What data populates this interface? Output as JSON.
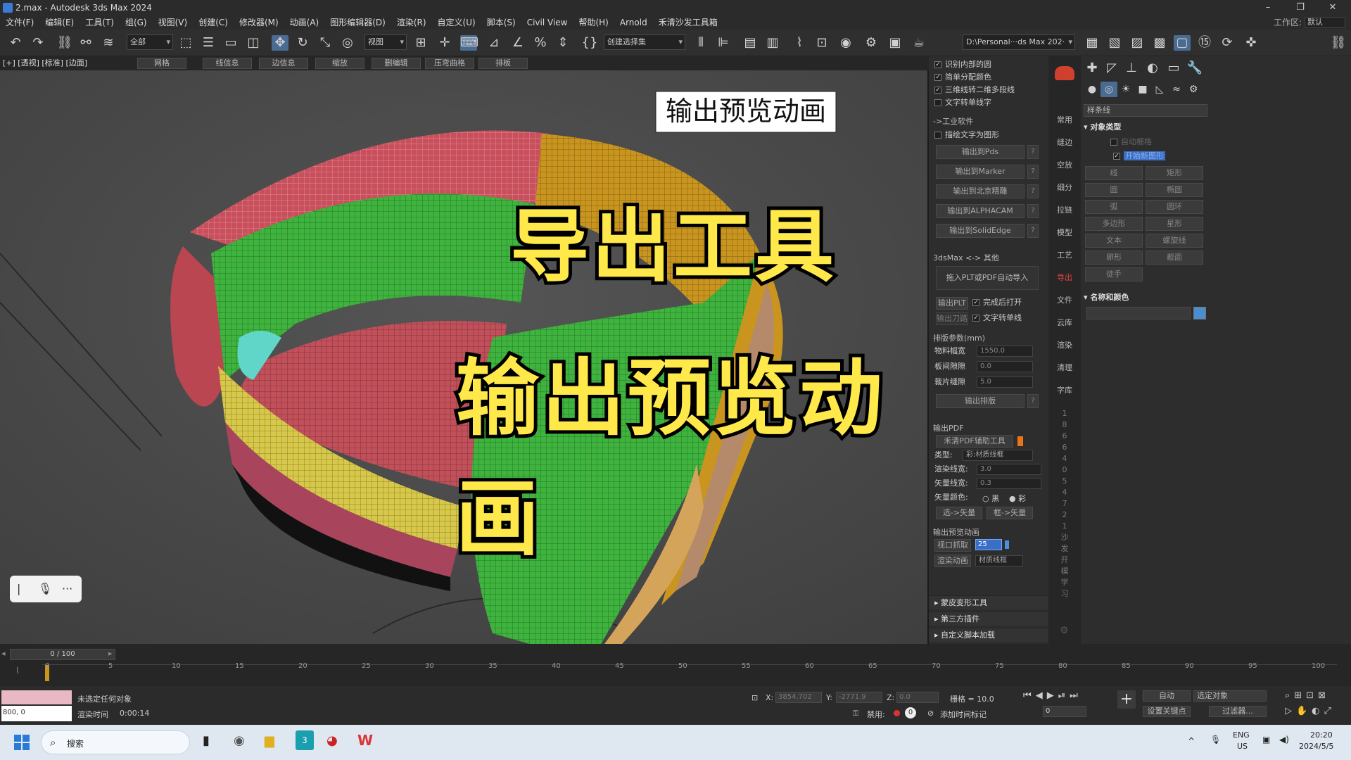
{
  "window": {
    "title": "2.max - Autodesk 3ds Max 2024",
    "minimize": "–",
    "maximize": "❐",
    "close": "✕"
  },
  "menu": {
    "items": [
      "文件(F)",
      "编辑(E)",
      "工具(T)",
      "组(G)",
      "视图(V)",
      "创建(C)",
      "修改器(M)",
      "动画(A)",
      "图形编辑器(D)",
      "渲染(R)",
      "自定义(U)",
      "脚本(S)",
      "Civil View",
      "帮助(H)",
      "Arnold",
      "禾清沙发工具箱"
    ],
    "workspace_label": "工作区:",
    "workspace_value": "默认"
  },
  "toolbar": {
    "selection_filter": "全部",
    "ref_coord": "视图",
    "named_set": "创建选择集",
    "path": "D:\\Personal···ds Max 202·"
  },
  "viewport": {
    "label": "[+] [透视] [标准] [边面]",
    "ribbon": [
      "网格",
      "线信息",
      "边信息",
      "缩放",
      "删编辑",
      "压弯曲格",
      "排板"
    ],
    "caption_box": "输出预览动画",
    "overlay_title": "导出工具",
    "overlay_subtitle": "输出预览动画"
  },
  "cmd": {
    "checks": [
      {
        "label": "识别内部的圆",
        "checked": true
      },
      {
        "label": "简单分配颜色",
        "checked": true
      },
      {
        "label": "三维线转二维多段线",
        "checked": true
      },
      {
        "label": "文字转单线字",
        "checked": false
      }
    ],
    "industrial_label": "->工业软件",
    "check_text_to_shape": "描绘文字为图形",
    "export_buttons": [
      "输出到Pds",
      "输出到Marker",
      "输出到北京精雕",
      "输出到ALPHACAM",
      "输出到SolidEdge"
    ],
    "help": "?",
    "other_label": "3dsMax <-> 其他",
    "drag_label": "拖入PLT或PDF自动导入",
    "plt_btn": "输出PLT",
    "knife_btn": "输出刀路",
    "open_after": "完成后打开",
    "text_to_line": "文字转单线",
    "nest_label": "排版参数(mm)",
    "params": [
      {
        "label": "物料幅宽",
        "value": "1550.0"
      },
      {
        "label": "板间隙隙",
        "value": "0.0"
      },
      {
        "label": "裁片缝隙",
        "value": "5.0"
      }
    ],
    "nest_btn": "输出排版",
    "pdf_label": "输出PDF",
    "pdf_tool": "禾清PDF辅助工具",
    "type_label": "类型:",
    "type_value": "彩:材质线框",
    "render_width_label": "渲染线宽:",
    "render_width": "3.0",
    "vector_width_label": "矢量线宽:",
    "vector_width": "0.3",
    "vector_color_label": "矢量颜色:",
    "black": "黑",
    "color": "彩",
    "sel_vector": "选->矢量",
    "frame_vector": "框->矢量",
    "preview_label": "输出预览动画",
    "vp_capture": "视口抓取",
    "vp_capture_val": "25",
    "render_anim": "渲染动画",
    "render_anim_val": "材质线框",
    "rollouts": [
      "蒙皮变形工具",
      "第三方插件",
      "自定义脚本加载"
    ]
  },
  "side_tabs": [
    "常用",
    "缝边",
    "空放",
    "细分",
    "拉链",
    "模型",
    "工艺",
    "导出",
    "文件",
    "云库",
    "渲染",
    "清理",
    "字库"
  ],
  "side_tab_active": "导出",
  "side_numbers": [
    "1",
    "8",
    "6",
    "6",
    "4",
    "0",
    "5",
    "4",
    "7",
    "2",
    "1",
    "沙",
    "发",
    "开",
    "模",
    "学",
    "习"
  ],
  "right": {
    "dropdown": "样条线",
    "object_type": "对象类型",
    "autogrid": "自动栅格",
    "start_new_shape": "开始新图形",
    "shape_buttons": [
      "线",
      "矩形",
      "圆",
      "椭圆",
      "弧",
      "圆环",
      "多边形",
      "星形",
      "文本",
      "螺旋线",
      "卵形",
      "截面",
      "徒手"
    ],
    "name_color": "名称和颜色"
  },
  "timeline": {
    "slider": "0 / 100",
    "ticks": [
      "0",
      "5",
      "10",
      "15",
      "20",
      "25",
      "30",
      "35",
      "40",
      "45",
      "50",
      "55",
      "60",
      "65",
      "70",
      "75",
      "80",
      "85",
      "90",
      "95",
      "100"
    ]
  },
  "status": {
    "selected": "未选定任何对象",
    "render_time_label": "渲染时间",
    "render_time": "0:00:14",
    "maxscript": "800, 0",
    "x_label": "X:",
    "x_val": "3854.702",
    "y_label": "Y:",
    "y_val": "-2771.9",
    "z_label": "Z:",
    "z_val": "0.0",
    "grid": "栅格 = 10.0",
    "disable": "禁用:",
    "add_time_tag": "添加时间标记",
    "auto": "自动",
    "selected_obj": "选定对象",
    "set_key": "设置关键点",
    "filters": "过滤器...",
    "frame": "0"
  },
  "taskbar": {
    "search": "搜索",
    "lang1": "ENG",
    "lang2": "US",
    "time": "20:20",
    "date": "2024/5/5"
  },
  "colors": {
    "accent": "#4a6c92",
    "overlay_text": "#ffe94a",
    "red_tab": "#e04040"
  }
}
